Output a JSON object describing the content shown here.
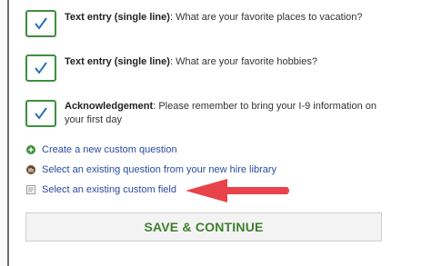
{
  "questions": [
    {
      "type": "Text entry (single line)",
      "sep": ": ",
      "text": "What are your favorite places to vacation?"
    },
    {
      "type": "Text entry (single line)",
      "sep": ": ",
      "text": "What are your favorite hobbies?"
    },
    {
      "type": "Acknowledgement",
      "sep": ": ",
      "text": "Please remember to bring your I-9 information on your first day"
    }
  ],
  "actions": {
    "create": "Create a new custom question",
    "library": "Select an existing question from your new hire library",
    "field": "Select an existing custom field"
  },
  "save_button": "SAVE & CONTINUE",
  "colors": {
    "accent_green": "#3e8f3e",
    "link_blue": "#2a4aa0",
    "arrow_red": "#e8424a"
  }
}
